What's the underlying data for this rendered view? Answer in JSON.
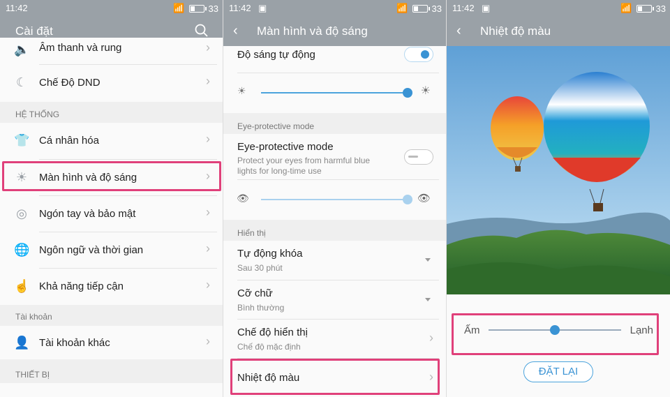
{
  "status": {
    "time": "11:42",
    "battery": "33"
  },
  "panel1": {
    "title": "Cài đặt",
    "items_top": [
      {
        "label": "Âm thanh và rung",
        "icon": "speaker-icon"
      },
      {
        "label": "Chế Độ DND",
        "icon": "moon-icon"
      }
    ],
    "section_system": "HỆ THỐNG",
    "items_system": [
      {
        "label": "Cá nhân hóa",
        "icon": "shirt-icon"
      },
      {
        "label": "Màn hình và độ sáng",
        "icon": "sun-icon"
      },
      {
        "label": "Ngón tay và bảo mật",
        "icon": "fingerprint-icon"
      },
      {
        "label": "Ngôn ngữ và thời gian",
        "icon": "globe-icon"
      },
      {
        "label": "Khả năng tiếp cận",
        "icon": "hand-icon"
      }
    ],
    "section_account": "Tài khoản",
    "items_account": [
      {
        "label": "Tài khoản khác",
        "icon": "person-icon"
      }
    ],
    "section_device": "THIẾT BỊ"
  },
  "panel2": {
    "title": "Màn hình và độ sáng",
    "auto_brightness": "Độ sáng tự động",
    "brightness_level": 1.0,
    "section_eye": "Eye-protective mode",
    "eye_mode_title": "Eye-protective mode",
    "eye_mode_desc1": "Protect your eyes from harmful blue",
    "eye_mode_desc2": "lights for long-time use",
    "eye_level": 1.0,
    "section_display": "Hiển thị",
    "auto_lock": {
      "title": "Tự động khóa",
      "value": "Sau 30 phút"
    },
    "font_size": {
      "title": "Cỡ chữ",
      "value": "Bình thường"
    },
    "display_mode": {
      "title": "Chế độ hiển thị",
      "value": "Chế độ mặc định"
    },
    "color_temp": "Nhiệt độ màu"
  },
  "panel3": {
    "title": "Nhiệt độ màu",
    "warm": "Ấm",
    "cold": "Lạnh",
    "temp_level": 0.5,
    "reset": "ĐẶT LẠI"
  },
  "colors": {
    "accent": "#3a93d4",
    "highlight": "#e0407a",
    "bar": "#9aa1a7"
  }
}
